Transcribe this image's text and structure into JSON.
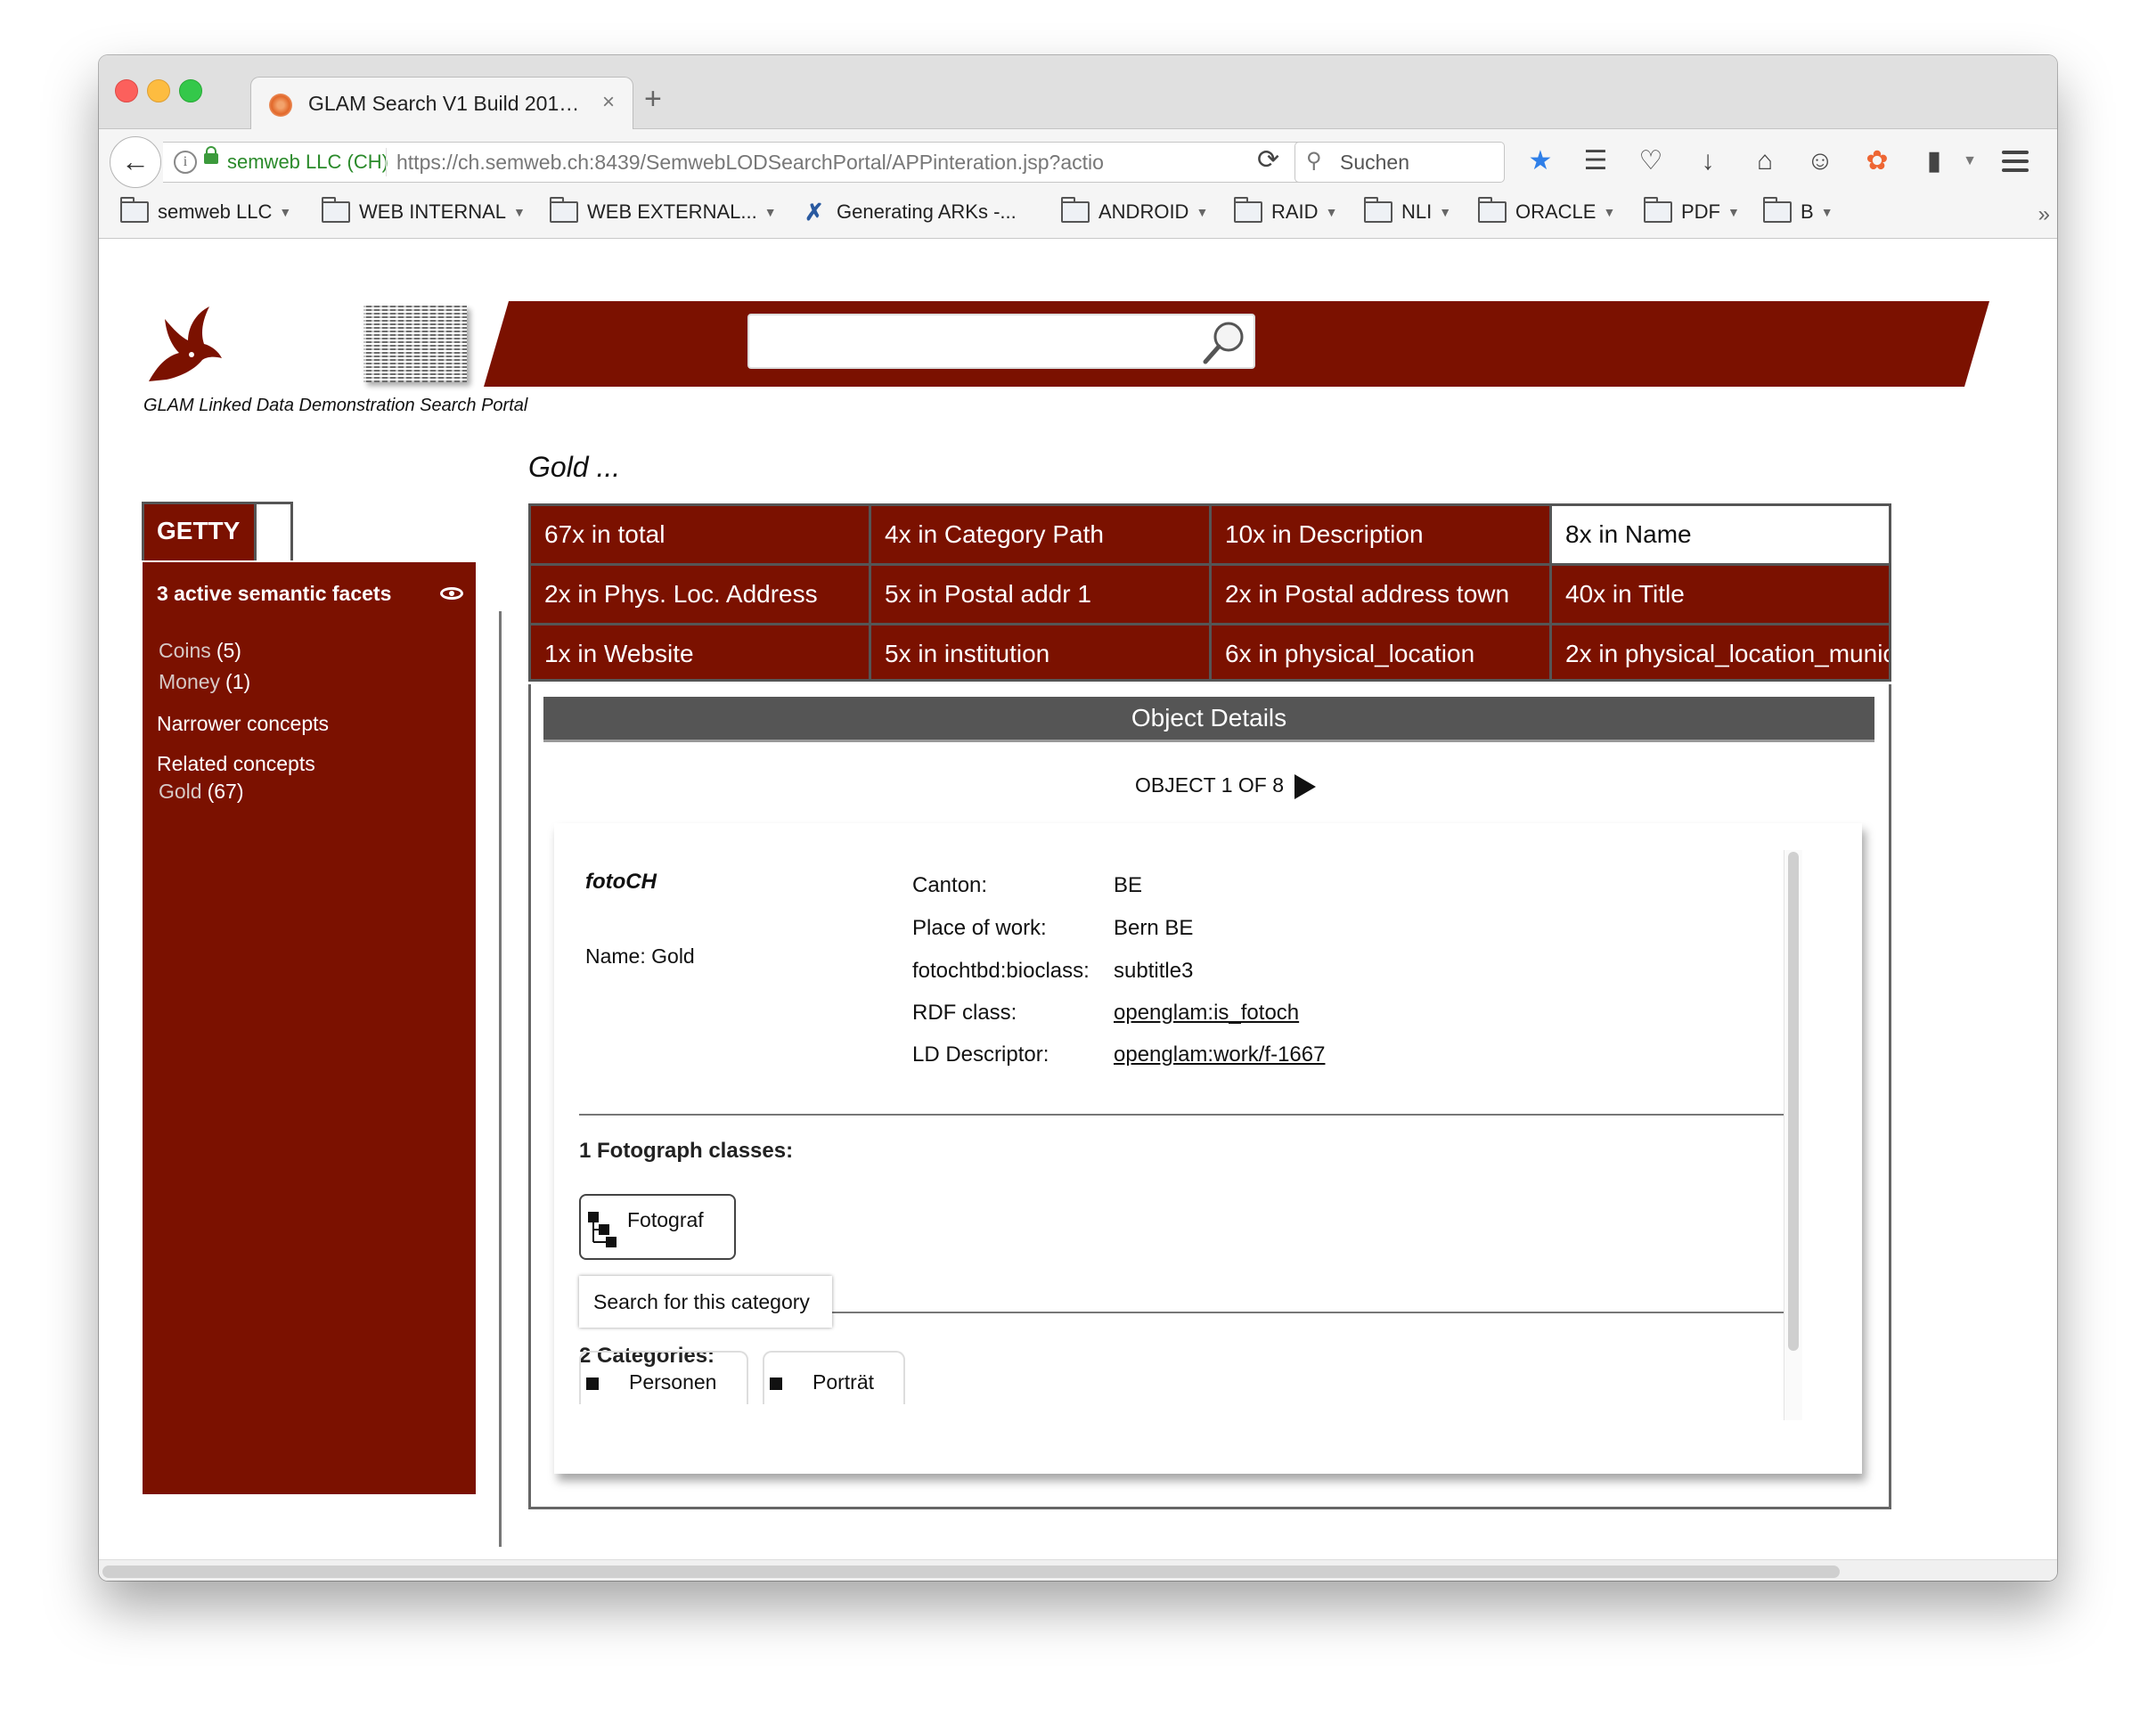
{
  "browser": {
    "tab_title": "GLAM Search V1 Build 201…",
    "tab_close": "×",
    "new_tab": "+",
    "identity": "semweb LLC (CH)",
    "url": "https://ch.semweb.ch:8439/SemwebLODSearchPortal/APPinteration.jsp?actio",
    "search_placeholder": "Suchen"
  },
  "bookmarks": [
    "semweb LLC",
    "WEB INTERNAL",
    "WEB EXTERNAL...",
    "Generating ARKs -...",
    "ANDROID",
    "RAID",
    "NLI",
    "ORACLE",
    "PDF",
    "B"
  ],
  "portal": {
    "caption": "GLAM Linked Data Demonstration Search Portal",
    "search_value": "",
    "query_title": "Gold ...",
    "brand_color": "#7b1100"
  },
  "facets": {
    "tab_label": "GETTY",
    "header": "3 active semantic facets",
    "items": [
      {
        "label": "Coins",
        "count": "(5)"
      },
      {
        "label": "Money",
        "count": "(1)"
      }
    ],
    "narrower_label": "Narrower concepts",
    "related_label": "Related concepts",
    "related_items": [
      {
        "label": "Gold",
        "count": "(67)"
      }
    ]
  },
  "hits": [
    {
      "label": "67x in total",
      "selected": false
    },
    {
      "label": "4x in Category Path",
      "selected": false
    },
    {
      "label": "10x in Description",
      "selected": false
    },
    {
      "label": "8x in Name",
      "selected": true
    },
    {
      "label": "2x in Phys. Loc. Address",
      "selected": false
    },
    {
      "label": "5x in Postal addr 1",
      "selected": false
    },
    {
      "label": "2x in Postal address town",
      "selected": false
    },
    {
      "label": "40x in Title",
      "selected": false
    },
    {
      "label": "1x in Website",
      "selected": false
    },
    {
      "label": "5x in institution",
      "selected": false
    },
    {
      "label": "6x in physical_location",
      "selected": false
    },
    {
      "label": "2x in physical_location_munic",
      "selected": false
    }
  ],
  "details": {
    "header": "Object Details",
    "pager": "OBJECT 1 OF 8",
    "source": "fotoCH",
    "name": "Name: Gold",
    "props": [
      {
        "key": "Canton:",
        "value": "BE",
        "link": false
      },
      {
        "key": "Place of work:",
        "value": "Bern BE",
        "link": false
      },
      {
        "key": "fotochtbd:bioclass:",
        "value": "subtitle3",
        "link": false
      },
      {
        "key": "RDF class:",
        "value": "openglam:is_fotoch",
        "link": true
      },
      {
        "key": "LD Descriptor:",
        "value": "openglam:work/f-1667",
        "link": true
      }
    ],
    "classes_title": "1 Fotograph classes:",
    "class_chip": "Fotograf",
    "tooltip": "Search for this category",
    "categories_title": "2 Categories:",
    "categories": [
      "Personen",
      "Porträt"
    ]
  }
}
